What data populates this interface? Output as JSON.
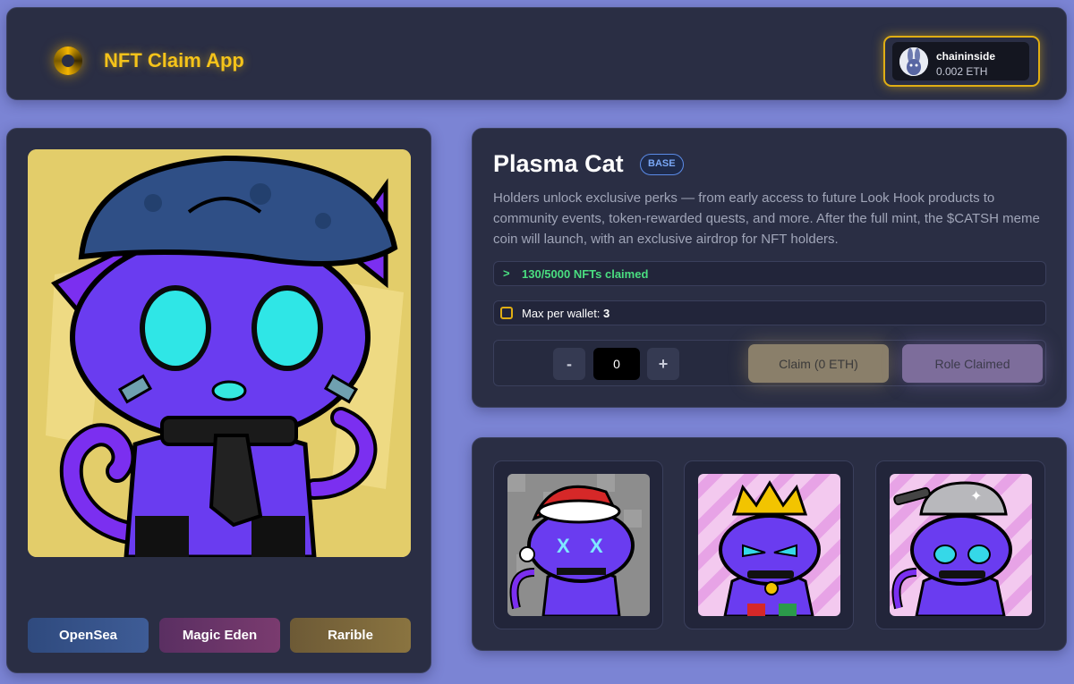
{
  "header": {
    "logo_icon": "spinning-coin-icon",
    "title": "NFT Claim App",
    "wallet": {
      "name": "chaininside",
      "balance": "0.002 ETH",
      "avatar_icon": "bunny-avatar"
    }
  },
  "nft": {
    "name": "Plasma Cat",
    "chain": "BASE",
    "description": "Holders unlock exclusive perks — from early access to future Look Hook products to community events, token-rewarded quests, and more. After the full mint, the $CATSH meme coin will launch, with an exclusive airdrop for NFT holders.",
    "claimed_text": "130/5000 NFTs claimed",
    "max_label": "Max per wallet: ",
    "max_value": "3",
    "quantity": "0",
    "minus_label": "-",
    "plus_label": "+",
    "claim_label": "Claim (0 ETH)",
    "role_label": "Role Claimed"
  },
  "marketplaces": {
    "opensea": "OpenSea",
    "magic_eden": "Magic Eden",
    "rarible": "Rarible"
  },
  "gallery": [
    {
      "variant": "santa-hat-cat"
    },
    {
      "variant": "crown-cat"
    },
    {
      "variant": "pot-hat-cat"
    }
  ],
  "colors": {
    "background": "#7b84d4",
    "panel": "#2a2e44",
    "accent_gold": "#f5c31a",
    "claimed_green": "#4ade80",
    "badge_blue": "#5b8be6"
  }
}
